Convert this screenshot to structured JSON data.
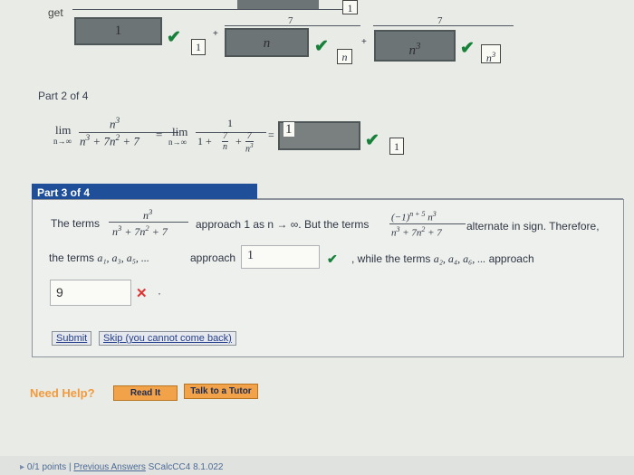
{
  "part1": {
    "prefix": "get",
    "answer1": "1",
    "plus": "+",
    "frac2_num": "7",
    "answer2": "n",
    "frac3_num": "7",
    "answer3": "n",
    "answer3_exp": "3",
    "result1": "1",
    "result2": "n",
    "result3": "n",
    "result3_exp": "3",
    "top_box": "1"
  },
  "part2": {
    "label": "Part 2 of 4",
    "lim": "lim",
    "lim_sub": "n→∞",
    "num": "n",
    "num_exp": "3",
    "den_a": "n",
    "den_a_exp": "3",
    "den_b": " + 7n",
    "den_b_exp": "2",
    "den_c": " + 7",
    "eq": "=",
    "lim2": "lim",
    "lim2_sub": "n→∞",
    "num2": "1",
    "den2_a": "1 +",
    "f1_num": "7",
    "f1_den": "n",
    "den2_plus": "+",
    "f2_num": "7",
    "f2_den": "n",
    "f2_den_exp": "3",
    "eq2": "=",
    "answer": "1",
    "result": "1"
  },
  "part3": {
    "label": "Part 3 of 4",
    "t1": "The terms",
    "fa_num": "n",
    "fa_num_exp": "3",
    "fa_den": "n",
    "fa_den_exp": "3",
    "fa_den_b": " + 7n",
    "fa_den_b_exp": "2",
    "fa_den_c": " + 7",
    "t2": "approach 1 as n → ∞. But the terms",
    "fb_num_a": "(−1)",
    "fb_num_a_exp": "n + 5",
    "fb_num_b": " n",
    "fb_num_b_exp": "3",
    "fb_den": "n",
    "fb_den_exp": "3",
    "fb_den_b": " + 7n",
    "fb_den_b_exp": "2",
    "fb_den_c": " + 7",
    "t3": "alternate in sign. Therefore,",
    "t4": "the terms a",
    "odd_terms": "a₁, a₃, a₅, ...",
    "t5": "approach",
    "odd_answer": "1",
    "t6": ", while the terms",
    "even_terms": "a₂, a₄, a₆, ...",
    "t7": "approach",
    "even_answer": "9",
    "submit": "Submit",
    "skip": "Skip (you cannot come back)"
  },
  "help": {
    "label": "Need Help?",
    "read": "Read It",
    "tutor": "Talk to a Tutor"
  },
  "footer": {
    "points": "0/1 points",
    "sep": "|",
    "prev": "Previous Answers",
    "code": "SCalcCC4 8.1.022"
  },
  "colors": {
    "header_blue": "#1f4f98",
    "check_green": "#17813a",
    "wrong_red": "#e03434"
  }
}
